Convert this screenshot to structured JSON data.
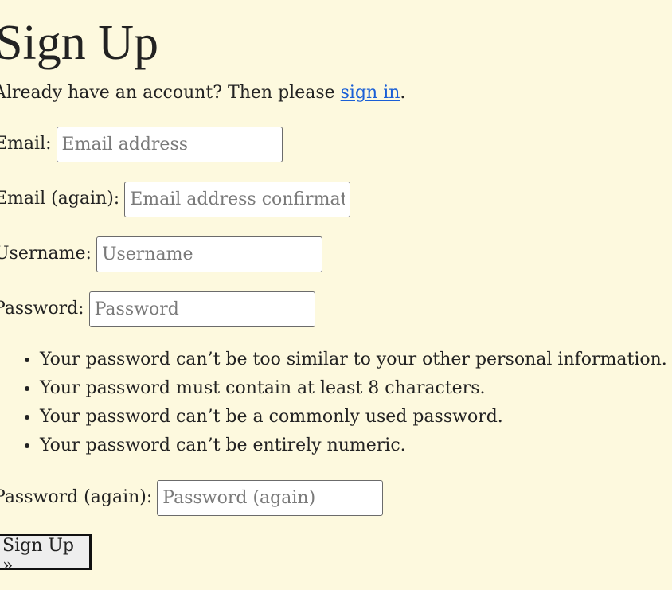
{
  "page": {
    "title": "Sign Up"
  },
  "intro": {
    "text_before": "Already have an account? Then please ",
    "link_label": "sign in",
    "text_after": "."
  },
  "form": {
    "email": {
      "label": "Email:",
      "placeholder": "Email address",
      "value": ""
    },
    "email_again": {
      "label": "Email (again):",
      "placeholder": "Email address confirmation",
      "value": ""
    },
    "username": {
      "label": "Username:",
      "placeholder": "Username",
      "value": ""
    },
    "password": {
      "label": "Password:",
      "placeholder": "Password",
      "value": ""
    },
    "password_help": [
      "Your password can’t be too similar to your other personal information.",
      "Your password must contain at least 8 characters.",
      "Your password can’t be a commonly used password.",
      "Your password can’t be entirely numeric."
    ],
    "password_again": {
      "label": "Password (again):",
      "placeholder": "Password (again)",
      "value": ""
    },
    "submit_label": "Sign Up »"
  },
  "colors": {
    "background": "#fdf9de",
    "link": "#1a5fd6",
    "text": "#222222"
  }
}
